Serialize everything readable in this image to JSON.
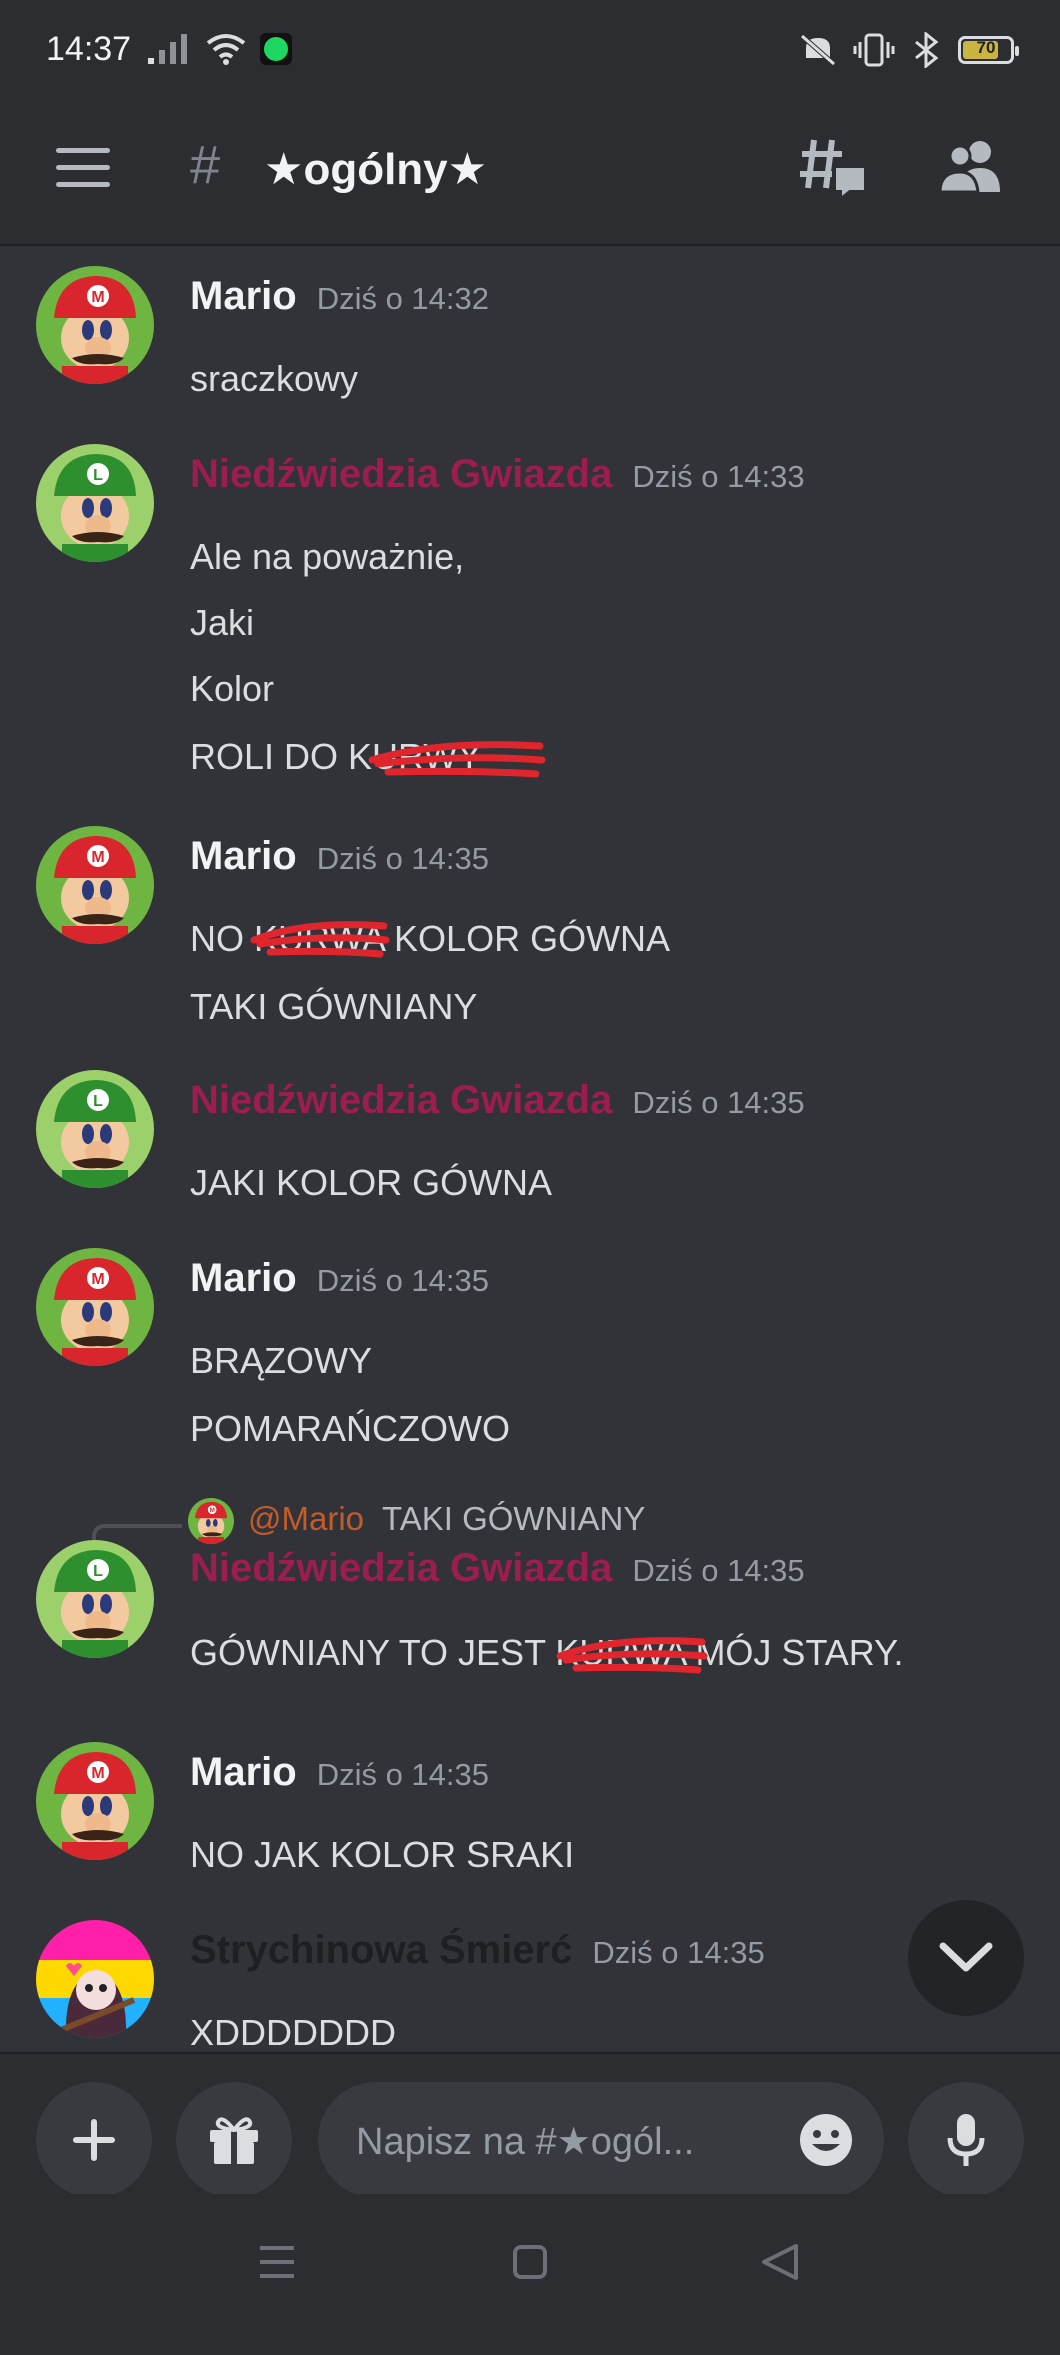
{
  "status_bar": {
    "time": "14:37",
    "battery": "70"
  },
  "header": {
    "hash": "#",
    "channel_name": "★ogólny★"
  },
  "messages": [
    {
      "author": "Mario",
      "author_color": "#f2f3f5",
      "timestamp": "Dziś o 14:32",
      "lines": [
        "sraczkowy"
      ]
    },
    {
      "author": "Niedźwiedzia Gwiazda",
      "author_color": "#9c1d4f",
      "timestamp": "Dziś o 14:33",
      "lines": [
        "Ale na poważnie,",
        "Jaki",
        "Kolor",
        "ROLI DO KURWY"
      ]
    },
    {
      "author": "Mario",
      "author_color": "#f2f3f5",
      "timestamp": "Dziś o 14:35",
      "lines": [
        "NO KURWA KOLOR GÓWNA",
        "TAKI GÓWNIANY"
      ]
    },
    {
      "author": "Niedźwiedzia Gwiazda",
      "author_color": "#9c1d4f",
      "timestamp": "Dziś o 14:35",
      "lines": [
        "JAKI KOLOR GÓWNA"
      ]
    },
    {
      "author": "Mario",
      "author_color": "#f2f3f5",
      "timestamp": "Dziś o 14:35",
      "lines": [
        "BRĄZOWY",
        "POMARAŃCZOWO"
      ]
    },
    {
      "reply": {
        "name": "@Mario",
        "text": "TAKI GÓWNIANY"
      },
      "author": "Niedźwiedzia Gwiazda",
      "author_color": "#9c1d4f",
      "timestamp": "Dziś o 14:35",
      "lines": [
        "GÓWNIANY TO JEST KURWA MÓJ STARY."
      ]
    },
    {
      "author": "Mario",
      "author_color": "#f2f3f5",
      "timestamp": "Dziś o 14:35",
      "lines": [
        "NO JAK KOLOR SRAKI"
      ]
    },
    {
      "author": "Strychinowa Śmierć",
      "author_color": "#1e1f22",
      "timestamp": "Dziś o 14:35",
      "lines": [
        "XDDDDDDD"
      ]
    }
  ],
  "composer": {
    "placeholder": "Napisz na #★ogól..."
  },
  "icons": {
    "menu": "hamburger-icon",
    "threads": "threads-icon",
    "members": "members-icon",
    "add": "plus-icon",
    "gift": "gift-icon",
    "emoji": "emoji-icon",
    "mic": "microphone-icon",
    "scroll": "chevron-down-icon"
  },
  "colors": {
    "background": "#313338",
    "panel": "#2b2d31",
    "role_pink": "#9c1d4f",
    "redaction": "#e0262c"
  }
}
